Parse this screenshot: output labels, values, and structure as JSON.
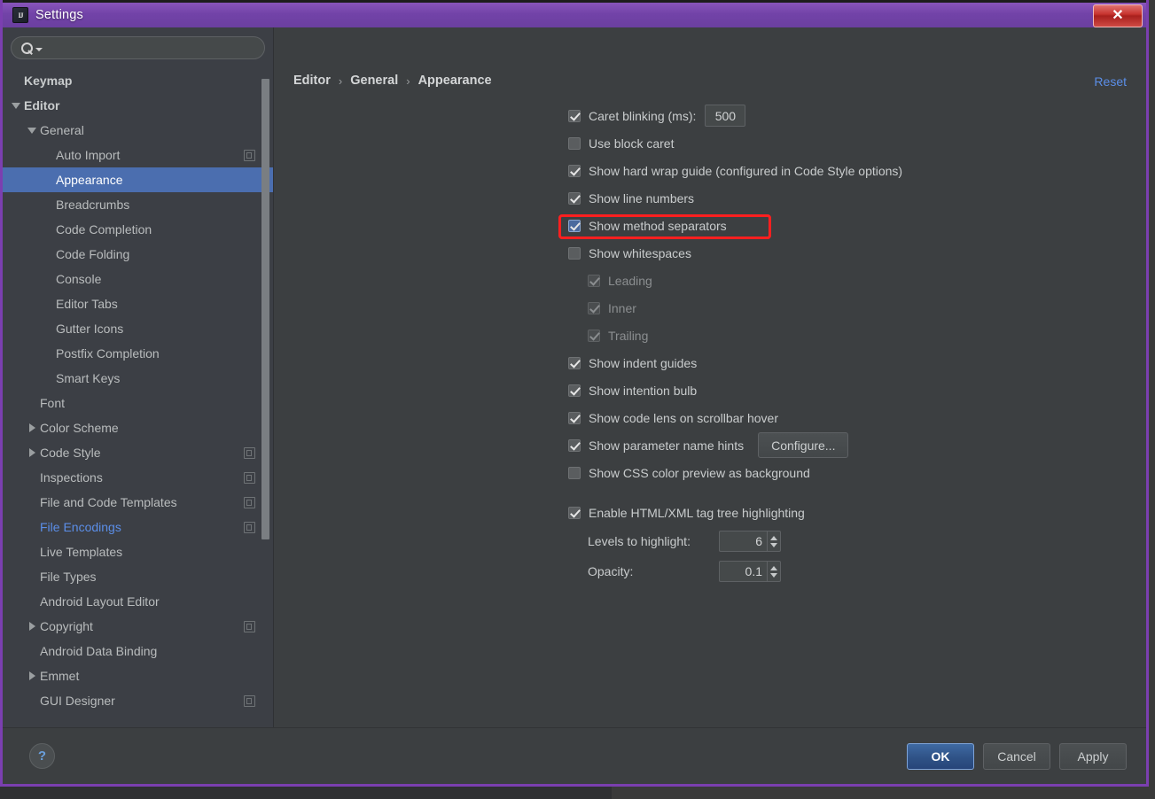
{
  "window": {
    "title": "Settings",
    "app_icon": "intellij-idea-icon",
    "close_label": "✕",
    "title_bar_color": "#6b3fa0",
    "accent_color": "#4b6eaf",
    "annotation_color": "#ff1f1f"
  },
  "sidebar": {
    "search": {
      "value": "",
      "placeholder": ""
    },
    "items": [
      {
        "label": "Keymap",
        "indent": 0,
        "twisty": "none",
        "bold": true,
        "selected": false,
        "modified": false,
        "copy": false
      },
      {
        "label": "Editor",
        "indent": 0,
        "twisty": "open",
        "bold": true,
        "selected": false,
        "modified": false,
        "copy": false
      },
      {
        "label": "General",
        "indent": 1,
        "twisty": "open",
        "bold": false,
        "selected": false,
        "modified": false,
        "copy": false
      },
      {
        "label": "Auto Import",
        "indent": 2,
        "twisty": "none",
        "bold": false,
        "selected": false,
        "modified": false,
        "copy": true
      },
      {
        "label": "Appearance",
        "indent": 2,
        "twisty": "none",
        "bold": false,
        "selected": true,
        "modified": false,
        "copy": false
      },
      {
        "label": "Breadcrumbs",
        "indent": 2,
        "twisty": "none",
        "bold": false,
        "selected": false,
        "modified": false,
        "copy": false
      },
      {
        "label": "Code Completion",
        "indent": 2,
        "twisty": "none",
        "bold": false,
        "selected": false,
        "modified": false,
        "copy": false
      },
      {
        "label": "Code Folding",
        "indent": 2,
        "twisty": "none",
        "bold": false,
        "selected": false,
        "modified": false,
        "copy": false
      },
      {
        "label": "Console",
        "indent": 2,
        "twisty": "none",
        "bold": false,
        "selected": false,
        "modified": false,
        "copy": false
      },
      {
        "label": "Editor Tabs",
        "indent": 2,
        "twisty": "none",
        "bold": false,
        "selected": false,
        "modified": false,
        "copy": false
      },
      {
        "label": "Gutter Icons",
        "indent": 2,
        "twisty": "none",
        "bold": false,
        "selected": false,
        "modified": false,
        "copy": false
      },
      {
        "label": "Postfix Completion",
        "indent": 2,
        "twisty": "none",
        "bold": false,
        "selected": false,
        "modified": false,
        "copy": false
      },
      {
        "label": "Smart Keys",
        "indent": 2,
        "twisty": "none",
        "bold": false,
        "selected": false,
        "modified": false,
        "copy": false
      },
      {
        "label": "Font",
        "indent": 1,
        "twisty": "none",
        "bold": false,
        "selected": false,
        "modified": false,
        "copy": false
      },
      {
        "label": "Color Scheme",
        "indent": 1,
        "twisty": "closed",
        "bold": false,
        "selected": false,
        "modified": false,
        "copy": false
      },
      {
        "label": "Code Style",
        "indent": 1,
        "twisty": "closed",
        "bold": false,
        "selected": false,
        "modified": false,
        "copy": true
      },
      {
        "label": "Inspections",
        "indent": 1,
        "twisty": "none",
        "bold": false,
        "selected": false,
        "modified": false,
        "copy": true
      },
      {
        "label": "File and Code Templates",
        "indent": 1,
        "twisty": "none",
        "bold": false,
        "selected": false,
        "modified": false,
        "copy": true
      },
      {
        "label": "File Encodings",
        "indent": 1,
        "twisty": "none",
        "bold": false,
        "selected": false,
        "modified": true,
        "copy": true
      },
      {
        "label": "Live Templates",
        "indent": 1,
        "twisty": "none",
        "bold": false,
        "selected": false,
        "modified": false,
        "copy": false
      },
      {
        "label": "File Types",
        "indent": 1,
        "twisty": "none",
        "bold": false,
        "selected": false,
        "modified": false,
        "copy": false
      },
      {
        "label": "Android Layout Editor",
        "indent": 1,
        "twisty": "none",
        "bold": false,
        "selected": false,
        "modified": false,
        "copy": false
      },
      {
        "label": "Copyright",
        "indent": 1,
        "twisty": "closed",
        "bold": false,
        "selected": false,
        "modified": false,
        "copy": true
      },
      {
        "label": "Android Data Binding",
        "indent": 1,
        "twisty": "none",
        "bold": false,
        "selected": false,
        "modified": false,
        "copy": false
      },
      {
        "label": "Emmet",
        "indent": 1,
        "twisty": "closed",
        "bold": false,
        "selected": false,
        "modified": false,
        "copy": false
      },
      {
        "label": "GUI Designer",
        "indent": 1,
        "twisty": "none",
        "bold": false,
        "selected": false,
        "modified": false,
        "copy": true
      }
    ]
  },
  "main": {
    "breadcrumb": {
      "root": "Editor",
      "mid": "General",
      "leaf": "Appearance",
      "separator": "›"
    },
    "reset_label": "Reset",
    "options": [
      {
        "label": "Caret blinking (ms):",
        "checked": true,
        "disabled": false,
        "field": "500"
      },
      {
        "label": "Use block caret",
        "checked": false,
        "disabled": false
      },
      {
        "label": "Show hard wrap guide (configured in Code Style options)",
        "checked": true,
        "disabled": false
      },
      {
        "label": "Show line numbers",
        "checked": true,
        "disabled": false
      },
      {
        "label": "Show method separators",
        "checked": true,
        "disabled": false,
        "focused": true,
        "annotated": true
      },
      {
        "label": "Show whitespaces",
        "checked": false,
        "disabled": false
      },
      {
        "label": "Leading",
        "checked": true,
        "disabled": true,
        "indented": true
      },
      {
        "label": "Inner",
        "checked": true,
        "disabled": true,
        "indented": true
      },
      {
        "label": "Trailing",
        "checked": true,
        "disabled": true,
        "indented": true
      },
      {
        "label": "Show indent guides",
        "checked": true,
        "disabled": false
      },
      {
        "label": "Show intention bulb",
        "checked": true,
        "disabled": false
      },
      {
        "label": "Show code lens on scrollbar hover",
        "checked": true,
        "disabled": false
      },
      {
        "label": "Show parameter name hints",
        "checked": true,
        "disabled": false,
        "button": "Configure..."
      },
      {
        "label": "Show CSS color preview as background",
        "checked": false,
        "disabled": false
      }
    ],
    "tag_tree": {
      "label": "Enable HTML/XML tag tree highlighting",
      "checked": true,
      "levels_label": "Levels to highlight:",
      "levels_value": "6",
      "opacity_label": "Opacity:",
      "opacity_value": "0.1"
    }
  },
  "footer": {
    "help_label": "?",
    "ok_label": "OK",
    "cancel_label": "Cancel",
    "apply_label": "Apply"
  }
}
